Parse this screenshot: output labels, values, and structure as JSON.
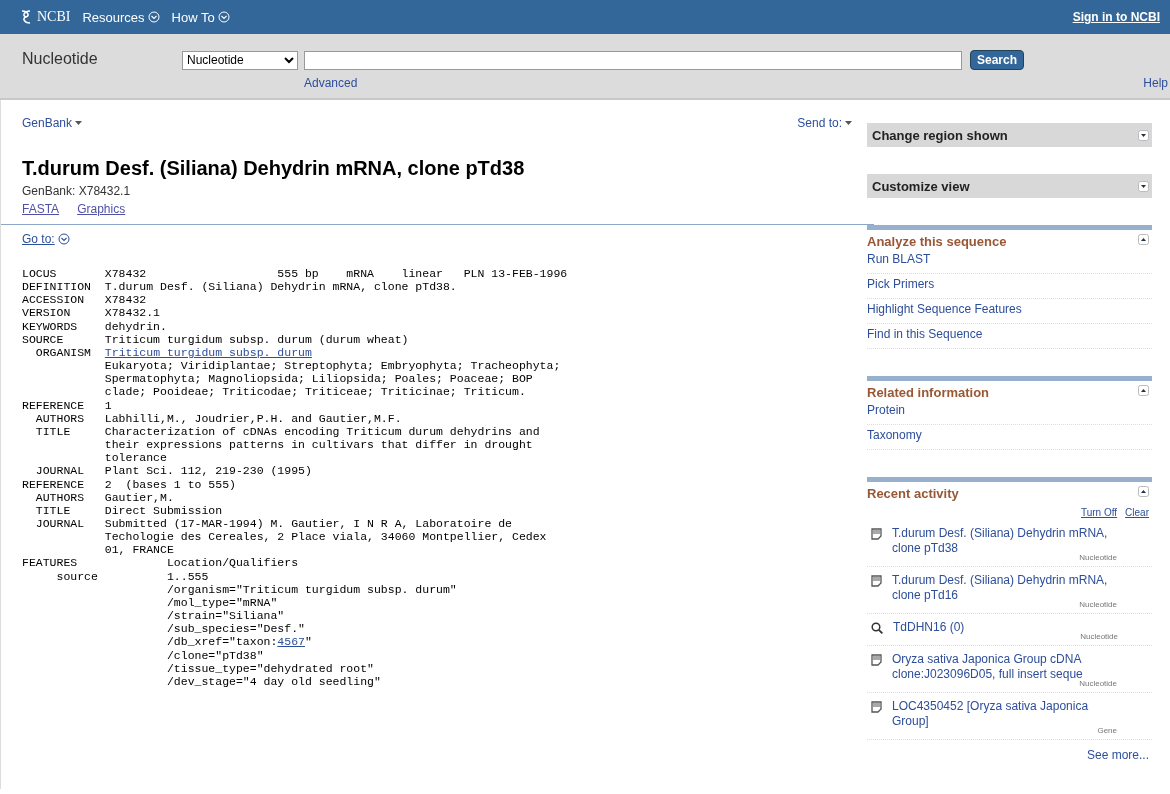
{
  "top_bar": {
    "logo": "NCBI",
    "menus": [
      "Resources",
      "How To"
    ],
    "sign_in": "Sign in to NCBI"
  },
  "search_bar": {
    "database_title": "Nucleotide",
    "database_select": "Nucleotide",
    "search_button": "Search",
    "advanced_link": "Advanced",
    "help_link": "Help"
  },
  "record": {
    "format_menu": "GenBank",
    "send_to": "Send to:",
    "title": "T.durum Desf. (Siliana) Dehydrin mRNA, clone pTd38",
    "accession_line": "GenBank: X78432.1",
    "links": [
      "FASTA",
      "Graphics"
    ],
    "go_to": "Go to:",
    "lines": [
      [
        {
          "text": "LOCUS       X78432                   555 bp    mRNA    linear   PLN 13-FEB-1996"
        }
      ],
      [
        {
          "text": "DEFINITION  T.durum Desf. (Siliana) Dehydrin mRNA, clone pTd38."
        }
      ],
      [
        {
          "text": "ACCESSION   X78432"
        }
      ],
      [
        {
          "text": "VERSION     X78432.1"
        }
      ],
      [
        {
          "text": "KEYWORDS    dehydrin."
        }
      ],
      [
        {
          "text": "SOURCE      Triticum turgidum subsp. durum (durum wheat)"
        }
      ],
      [
        {
          "text": "  ORGANISM  "
        },
        {
          "text": "Triticum turgidum subsp. durum",
          "link": true
        }
      ],
      [
        {
          "text": "            Eukaryota; Viridiplantae; Streptophyta; Embryophyta; Tracheophyta;"
        }
      ],
      [
        {
          "text": "            Spermatophyta; Magnoliopsida; Liliopsida; Poales; Poaceae; BOP"
        }
      ],
      [
        {
          "text": "            clade; Pooideae; Triticodae; Triticeae; Triticinae; Triticum."
        }
      ],
      [
        {
          "text": "REFERENCE   1"
        }
      ],
      [
        {
          "text": "  AUTHORS   Labhilli,M., Joudrier,P.H. and Gautier,M.F."
        }
      ],
      [
        {
          "text": "  TITLE     Characterization of cDNAs encoding Triticum durum dehydrins and"
        }
      ],
      [
        {
          "text": "            their expressions patterns in cultivars that differ in drought"
        }
      ],
      [
        {
          "text": "            tolerance"
        }
      ],
      [
        {
          "text": "  JOURNAL   Plant Sci. 112, 219-230 (1995)"
        }
      ],
      [
        {
          "text": "REFERENCE   2  (bases 1 to 555)"
        }
      ],
      [
        {
          "text": "  AUTHORS   Gautier,M."
        }
      ],
      [
        {
          "text": "  TITLE     Direct Submission"
        }
      ],
      [
        {
          "text": "  JOURNAL   Submitted (17-MAR-1994) M. Gautier, I N R A, Laboratoire de"
        }
      ],
      [
        {
          "text": "            Techologie des Cereales, 2 Place viala, 34060 Montpellier, Cedex"
        }
      ],
      [
        {
          "text": "            01, FRANCE"
        }
      ],
      [
        {
          "text": "FEATURES             Location/Qualifiers"
        }
      ],
      [
        {
          "text": "     source          1..555"
        }
      ],
      [
        {
          "text": "                     /organism=\"Triticum turgidum subsp. durum\""
        }
      ],
      [
        {
          "text": "                     /mol_type=\"mRNA\""
        }
      ],
      [
        {
          "text": "                     /strain=\"Siliana\""
        }
      ],
      [
        {
          "text": "                     /sub_species=\"Desf.\""
        }
      ],
      [
        {
          "text": "                     /db_xref=\"taxon:"
        },
        {
          "text": "4567",
          "link": true
        },
        {
          "text": "\""
        }
      ],
      [
        {
          "text": "                     /clone=\"pTd38\""
        }
      ],
      [
        {
          "text": "                     /tissue_type=\"dehydrated root\""
        }
      ],
      [
        {
          "text": "                     /dev_stage=\"4 day old seedling\""
        }
      ]
    ]
  },
  "sidebar": {
    "panels": [
      {
        "title": "Change region shown",
        "expanded": false
      },
      {
        "title": "Customize view",
        "expanded": false
      },
      {
        "title": "Analyze this sequence",
        "expanded": true,
        "links": [
          "Run BLAST",
          "Pick Primers",
          "Highlight Sequence Features",
          "Find in this Sequence"
        ]
      },
      {
        "title": "Related information",
        "expanded": true,
        "links": [
          "Protein",
          "Taxonomy"
        ]
      },
      {
        "title": "Recent activity",
        "expanded": true,
        "actions": [
          "Turn Off",
          "Clear"
        ],
        "items": [
          {
            "kind": "document",
            "text": "T.durum Desf. (Siliana) Dehydrin mRNA, clone pTd38",
            "database": "Nucleotide"
          },
          {
            "kind": "document",
            "text": "T.durum Desf. (Siliana) Dehydrin mRNA, clone pTd16",
            "database": "Nucleotide"
          },
          {
            "kind": "search",
            "text": "TdDHN16 (0)",
            "database": "Nucleotide"
          },
          {
            "kind": "document",
            "text": "Oryza sativa Japonica Group cDNA clone:J023096D05, full insert seque",
            "database": "Nucleotide"
          },
          {
            "kind": "document",
            "text": "LOC4350452 [Oryza sativa Japonica Group]",
            "database": "Gene"
          }
        ],
        "more": "See more..."
      }
    ]
  }
}
